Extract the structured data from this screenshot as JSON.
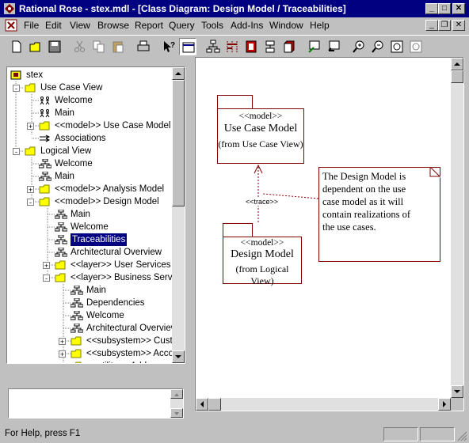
{
  "window": {
    "title": "Rational Rose - stex.mdl - [Class Diagram: Design Model / Traceabilities]"
  },
  "menu": [
    "File",
    "Edit",
    "View",
    "Browse",
    "Report",
    "Query",
    "Tools",
    "Add-Ins",
    "Window",
    "Help"
  ],
  "tree": {
    "root": "stex",
    "items": [
      {
        "label": "Use Case View",
        "icon": "folder-icon"
      },
      {
        "label": "Welcome",
        "icon": "usecase-diagram-icon"
      },
      {
        "label": "Main",
        "icon": "usecase-diagram-icon"
      },
      {
        "label": "<<model>> Use Case Model",
        "icon": "folder-icon"
      },
      {
        "label": "Associations",
        "icon": "associations-icon"
      },
      {
        "label": "Logical View",
        "icon": "folder-icon"
      },
      {
        "label": "Welcome",
        "icon": "class-diagram-icon"
      },
      {
        "label": "Main",
        "icon": "class-diagram-icon"
      },
      {
        "label": "<<model>> Analysis Model",
        "icon": "folder-icon"
      },
      {
        "label": "<<model>> Design Model",
        "icon": "folder-icon"
      },
      {
        "label": "Main",
        "icon": "class-diagram-icon"
      },
      {
        "label": "Welcome",
        "icon": "class-diagram-icon"
      },
      {
        "label": "Traceabilities",
        "icon": "class-diagram-icon"
      },
      {
        "label": "Architectural Overview",
        "icon": "class-diagram-icon"
      },
      {
        "label": "<<layer>> User Services",
        "icon": "folder-icon"
      },
      {
        "label": "<<layer>> Business Services",
        "icon": "folder-icon"
      },
      {
        "label": "Main",
        "icon": "class-diagram-icon"
      },
      {
        "label": "Dependencies",
        "icon": "class-diagram-icon"
      },
      {
        "label": "Welcome",
        "icon": "class-diagram-icon"
      },
      {
        "label": "Architectural Overview",
        "icon": "class-diagram-icon"
      },
      {
        "label": "<<subsystem>> Customer",
        "icon": "folder-icon"
      },
      {
        "label": "<<subsystem>> Account",
        "icon": "folder-icon"
      },
      {
        "label": "<<utility>> Address",
        "icon": "folder-icon"
      }
    ]
  },
  "diagram": {
    "pkg1": {
      "stereo": "<<model>>",
      "name": "Use Case Model",
      "from": "(from Use Case View)"
    },
    "pkg2": {
      "stereo": "<<model>>",
      "name": "Design Model",
      "from": "(from Logical View)"
    },
    "trace_label": "<<trace>>",
    "note_lines": [
      "The Design Model is",
      "dependent on the use",
      "case model as it will",
      "contain realizations of",
      "the use cases."
    ]
  },
  "status": {
    "text": "For Help, press F1"
  },
  "colors": {
    "titlebar": "#000080",
    "diagram_line": "#800000",
    "folder": "#ffff00",
    "selection": "#000080"
  }
}
